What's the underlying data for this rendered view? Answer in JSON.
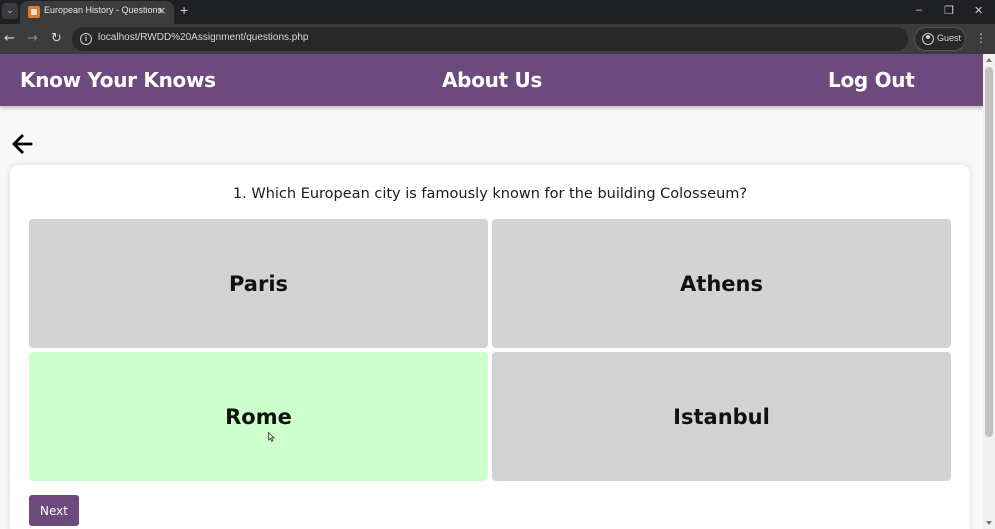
{
  "browser": {
    "tab_title": "European History - Questions",
    "tab_close": "×",
    "new_tab": "+",
    "url": "localhost/RWDD%20Assignment/questions.php",
    "profile_label": "Guest",
    "window_controls": {
      "minimize": "–",
      "restore": "❐",
      "close": "✕"
    },
    "nav": {
      "back": "←",
      "forward": "→",
      "reload": "↻"
    },
    "menu": "⋮",
    "tab_menu": "⌄"
  },
  "header": {
    "brand": "Know Your Knows",
    "about": "About Us",
    "logout": "Log Out",
    "color": "#6c4a7e"
  },
  "quiz": {
    "question": "1. Which European city is famously known for the building Colosseum?",
    "answers": [
      {
        "label": "Paris",
        "state": "default"
      },
      {
        "label": "Athens",
        "state": "default"
      },
      {
        "label": "Rome",
        "state": "correct"
      },
      {
        "label": "Istanbul",
        "state": "default"
      }
    ],
    "next_label": "Next",
    "answer_color": "#d3d3d3",
    "correct_color": "#ccffcc"
  }
}
